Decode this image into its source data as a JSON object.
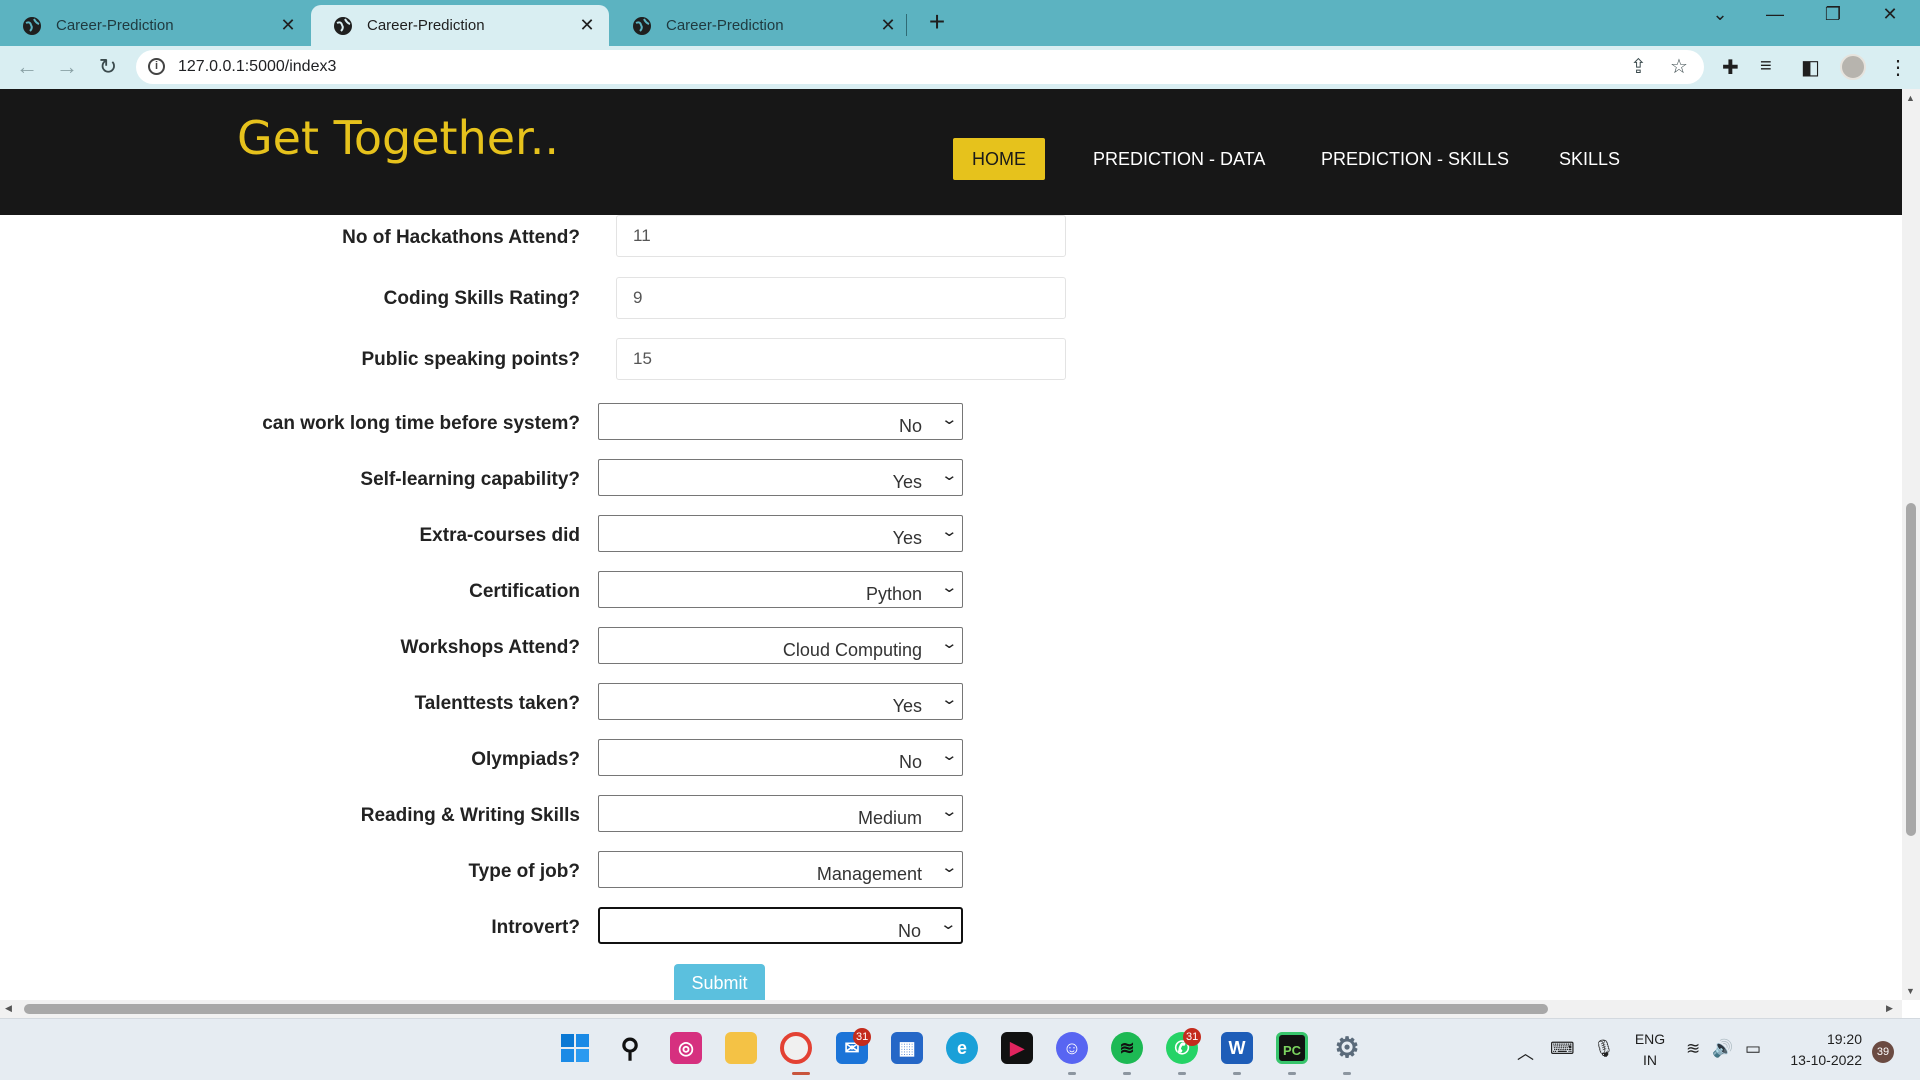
{
  "browser": {
    "tabs": [
      {
        "title": "Career-Prediction",
        "active": false
      },
      {
        "title": "Career-Prediction",
        "active": true
      },
      {
        "title": "Career-Prediction",
        "active": false
      }
    ],
    "url": "127.0.0.1:5000/index3"
  },
  "site": {
    "brand": "Get Together..",
    "nav": [
      {
        "label": "HOME",
        "active": true
      },
      {
        "label": "PREDICTION - DATA",
        "active": false
      },
      {
        "label": "PREDICTION - SKILLS",
        "active": false
      },
      {
        "label": "SKILLS",
        "active": false
      }
    ]
  },
  "form": {
    "text_fields": [
      {
        "label": "No of Hackathons Attend?",
        "value": "11"
      },
      {
        "label": "Coding Skills Rating?",
        "value": "9"
      },
      {
        "label": "Public speaking points?",
        "value": "15"
      }
    ],
    "select_fields": [
      {
        "label": "can work long time before system?",
        "value": "No"
      },
      {
        "label": "Self-learning capability?",
        "value": "Yes"
      },
      {
        "label": "Extra-courses did",
        "value": "Yes"
      },
      {
        "label": "Certification",
        "value": "Python"
      },
      {
        "label": "Workshops Attend?",
        "value": "Cloud Computing"
      },
      {
        "label": "Talenttests taken?",
        "value": "Yes"
      },
      {
        "label": "Olympiads?",
        "value": "No"
      },
      {
        "label": "Reading & Writing Skills",
        "value": "Medium"
      },
      {
        "label": "Type of job?",
        "value": "Management"
      },
      {
        "label": "Introvert?",
        "value": "No"
      }
    ],
    "submit_label": "Submit"
  },
  "taskbar": {
    "badges": {
      "mail": "31",
      "whatsapp": "31"
    },
    "language": "ENG",
    "region": "IN",
    "time": "19:20",
    "date": "13-10-2022",
    "notifications": "39"
  },
  "colors": {
    "tabbar": "#5cb3c1",
    "header_bg": "#171717",
    "brand": "#e6c21c",
    "submit": "#5bc0de"
  }
}
